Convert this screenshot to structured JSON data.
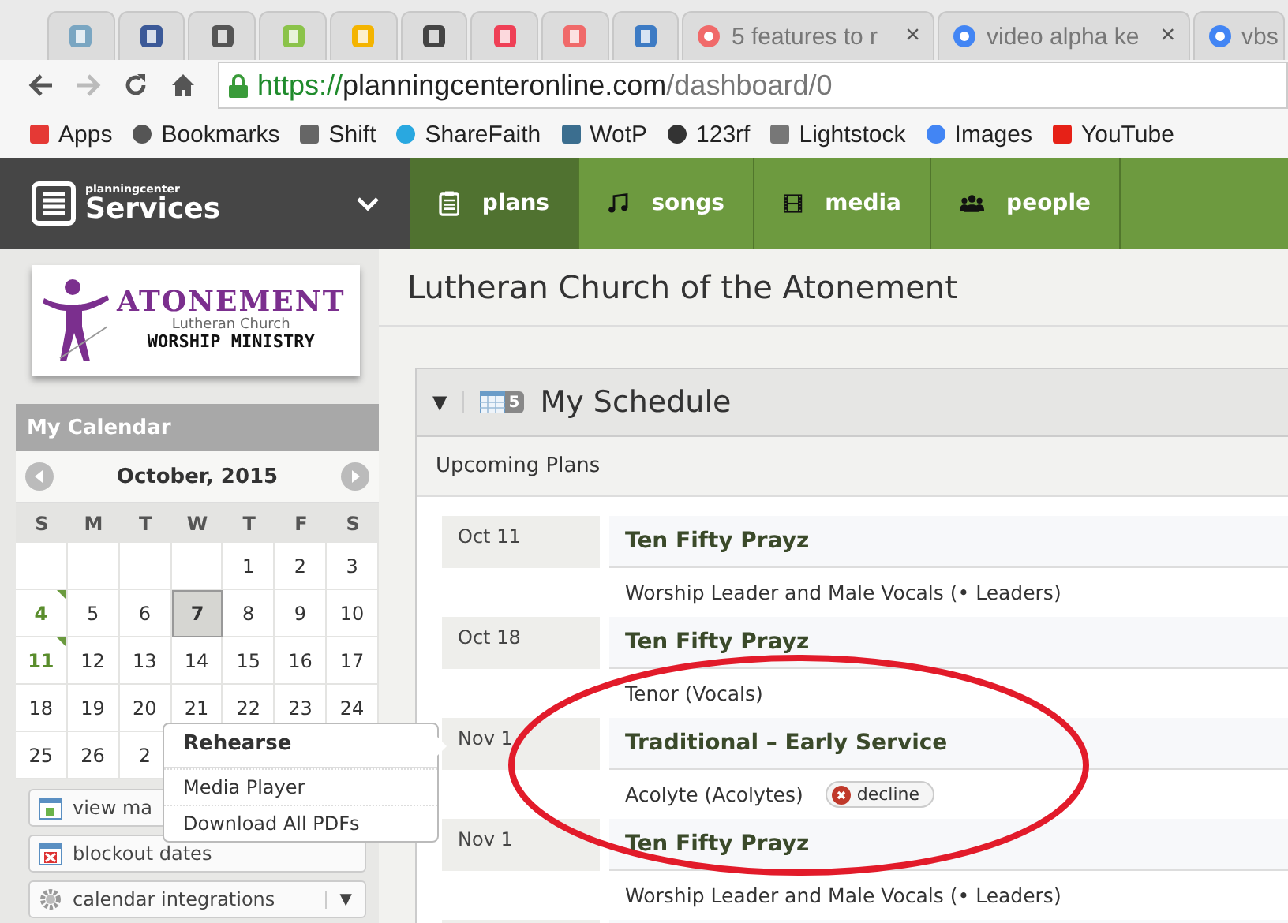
{
  "browser": {
    "tabs": [
      {
        "kind": "pinned"
      },
      {
        "kind": "pinned"
      },
      {
        "kind": "pinned"
      },
      {
        "kind": "pinned"
      },
      {
        "kind": "pinned"
      },
      {
        "kind": "pinned"
      },
      {
        "kind": "pinned"
      },
      {
        "kind": "pinned"
      },
      {
        "kind": "pinned"
      },
      {
        "kind": "page",
        "title": "5 features to r",
        "close": "×"
      },
      {
        "kind": "page",
        "title": "video alpha ke",
        "close": "×"
      },
      {
        "kind": "page",
        "title": "vbs"
      }
    ],
    "address": {
      "scheme": "https://",
      "host": "planningcenteronline.com",
      "path": "/dashboard/0"
    },
    "bookmarks": [
      "Apps",
      "Bookmarks",
      "Shift",
      "ShareFaith",
      "WotP",
      "123rf",
      "Lightstock",
      "Images",
      "YouTube"
    ]
  },
  "brand": {
    "small": "planningcenter",
    "name": "Services"
  },
  "nav": [
    {
      "label": "plans",
      "selected": true
    },
    {
      "label": "songs",
      "selected": false
    },
    {
      "label": "media",
      "selected": false
    },
    {
      "label": "people",
      "selected": false
    }
  ],
  "logo": {
    "title": "ATONEMENT",
    "subtitle": "Lutheran Church",
    "tagline": "WORSHIP MINISTRY"
  },
  "calendar": {
    "title": "My Calendar",
    "month": "October, 2015",
    "weekdays": [
      "S",
      "M",
      "T",
      "W",
      "T",
      "F",
      "S"
    ],
    "weeks": [
      [
        {
          "marked": false,
          "selected": false
        },
        {
          "marked": false,
          "selected": false
        },
        {
          "marked": false,
          "selected": false
        },
        {
          "marked": false,
          "selected": false
        },
        {
          "day": "1",
          "marked": false,
          "selected": false
        },
        {
          "day": "2",
          "marked": false,
          "selected": false
        },
        {
          "day": "3",
          "marked": false,
          "selected": false
        }
      ],
      [
        {
          "day": "4",
          "marked": true,
          "selected": false
        },
        {
          "day": "5",
          "marked": false,
          "selected": false
        },
        {
          "day": "6",
          "marked": false,
          "selected": false
        },
        {
          "day": "7",
          "marked": false,
          "selected": true
        },
        {
          "day": "8",
          "marked": false,
          "selected": false
        },
        {
          "day": "9",
          "marked": false,
          "selected": false
        },
        {
          "day": "10",
          "marked": false,
          "selected": false
        }
      ],
      [
        {
          "day": "11",
          "marked": true,
          "selected": false
        },
        {
          "day": "12",
          "marked": false,
          "selected": false
        },
        {
          "day": "13",
          "marked": false,
          "selected": false
        },
        {
          "day": "14",
          "marked": false,
          "selected": false
        },
        {
          "day": "15",
          "marked": false,
          "selected": false
        },
        {
          "day": "16",
          "marked": false,
          "selected": false
        },
        {
          "day": "17",
          "marked": false,
          "selected": false
        }
      ],
      [
        {
          "day": "18",
          "marked": false,
          "selected": false
        },
        {
          "day": "19",
          "marked": false,
          "selected": false
        },
        {
          "day": "20",
          "marked": false,
          "selected": false
        },
        {
          "day": "21",
          "marked": false,
          "selected": false
        },
        {
          "day": "22",
          "marked": false,
          "selected": false
        },
        {
          "day": "23",
          "marked": false,
          "selected": false
        },
        {
          "day": "24",
          "marked": false,
          "selected": false
        }
      ],
      [
        {
          "day": "25",
          "marked": false,
          "selected": false
        },
        {
          "day": "26",
          "marked": false,
          "selected": false
        },
        {
          "day": "2",
          "marked": false,
          "selected": false
        }
      ]
    ],
    "buttons": [
      {
        "kind": "calendar",
        "label": "view ma"
      },
      {
        "kind": "blockout",
        "label": "blockout dates"
      },
      {
        "kind": "gear",
        "label": "calendar integrations",
        "caret": "▼"
      }
    ]
  },
  "popup": [
    {
      "kind": "header",
      "label": "Rehearse"
    },
    {
      "kind": "item",
      "label": "Media Player"
    },
    {
      "kind": "item",
      "label": "Download All PDFs"
    }
  ],
  "main": {
    "title": "Lutheran Church of the Atonement",
    "schedule": {
      "toggle": "▼",
      "badge": "5",
      "title": "My Schedule",
      "subtitle": "Upcoming Plans",
      "plans": [
        {
          "date": "Oct 11",
          "title": "Ten Fifty Prayz",
          "role": "Worship Leader and Male Vocals (• Leaders)"
        },
        {
          "date": "Oct 18",
          "title": "Ten Fifty Prayz",
          "role": "Tenor (Vocals)"
        },
        {
          "date": "Nov 1",
          "title": "Traditional – Early Service",
          "role": "Acolyte (Acolytes)",
          "action": "decline"
        },
        {
          "date": "Nov 1",
          "title": "Ten Fifty Prayz",
          "role": "Worship Leader and Male Vocals (• Leaders)"
        }
      ]
    }
  }
}
